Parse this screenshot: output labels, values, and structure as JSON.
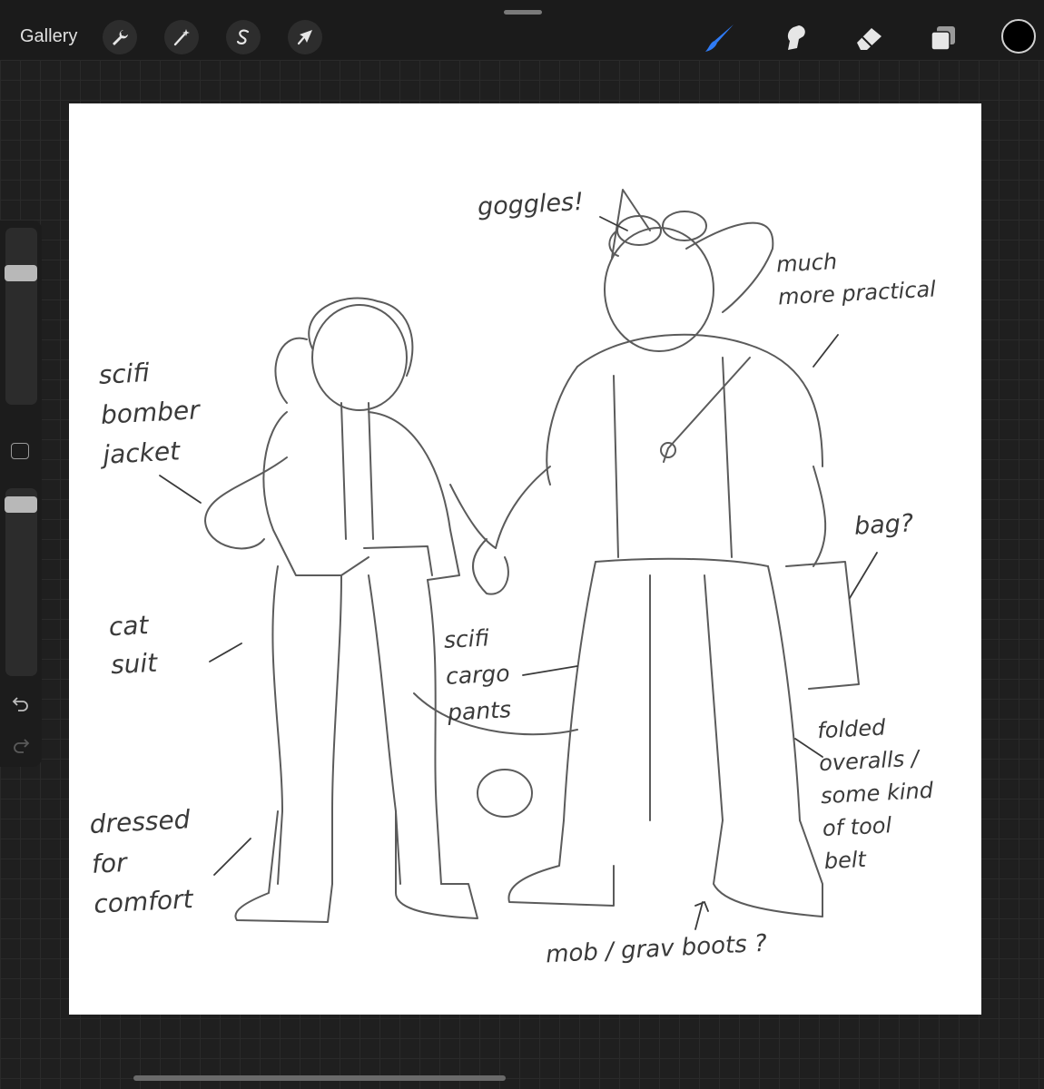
{
  "toolbar": {
    "gallery_label": "Gallery",
    "left_tools": [
      "wrench-icon",
      "magic-wand-icon",
      "selection-s-icon",
      "transform-arrow-icon"
    ],
    "right_tools": [
      "brush-icon",
      "smudge-icon",
      "eraser-icon",
      "layers-icon"
    ],
    "active_tool": "brush-icon",
    "accent_color": "#2f7bf5",
    "current_color": "#000000"
  },
  "sidebar": {
    "brush_size_level": 0.23,
    "opacity_level": 0.05,
    "modify_icon": "square-icon",
    "undo_icon": "undo-icon",
    "redo_icon": "redo-icon"
  },
  "canvas": {
    "annotations": {
      "goggles": "goggles!",
      "practical": "much\nmore practical",
      "bomber": "scifi\nbomber\njacket",
      "bag": "bag?",
      "catsuit": "cat\nsuit",
      "cargo": "scifi\ncargo\npants",
      "overalls": "folded\noveralls /\nsome kind\nof tool\nbelt",
      "dressed": "dressed\nfor\ncomfort",
      "boots": "mob / grav boots ?"
    }
  }
}
